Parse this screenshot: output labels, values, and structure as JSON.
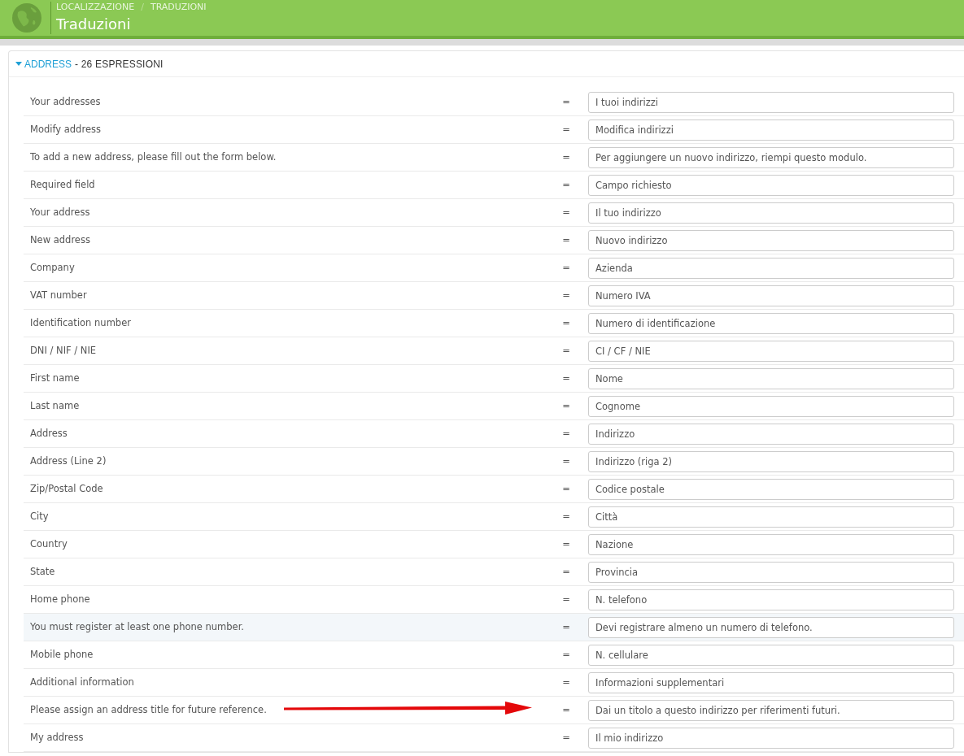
{
  "header": {
    "breadcrumb": [
      "LOCALIZZAZIONE",
      "TRADUZIONI"
    ],
    "separator": "/",
    "title": "Traduzioni"
  },
  "section": {
    "name": "ADDRESS",
    "count": "- 26 ESPRESSIONI",
    "expanded": true
  },
  "rows": [
    {
      "source": "Your addresses",
      "equals": "=",
      "value": "I tuoi indirizzi",
      "highlighted": false,
      "arrow": false
    },
    {
      "source": "Modify address",
      "equals": "=",
      "value": "Modifica indirizzi",
      "highlighted": false,
      "arrow": false
    },
    {
      "source": "To add a new address, please fill out the form below.",
      "equals": "=",
      "value": "Per aggiungere un nuovo indirizzo, riempi questo modulo.",
      "highlighted": false,
      "arrow": false
    },
    {
      "source": "Required field",
      "equals": "=",
      "value": "Campo richiesto",
      "highlighted": false,
      "arrow": false
    },
    {
      "source": "Your address",
      "equals": "=",
      "value": "Il tuo indirizzo",
      "highlighted": false,
      "arrow": false
    },
    {
      "source": "New address",
      "equals": "=",
      "value": "Nuovo indirizzo",
      "highlighted": false,
      "arrow": false
    },
    {
      "source": "Company",
      "equals": "=",
      "value": "Azienda",
      "highlighted": false,
      "arrow": false
    },
    {
      "source": "VAT number",
      "equals": "=",
      "value": "Numero IVA",
      "highlighted": false,
      "arrow": false
    },
    {
      "source": "Identification number",
      "equals": "=",
      "value": "Numero di identificazione",
      "highlighted": false,
      "arrow": false
    },
    {
      "source": "DNI / NIF / NIE",
      "equals": "=",
      "value": "CI / CF / NIE",
      "highlighted": false,
      "arrow": false
    },
    {
      "source": "First name",
      "equals": "=",
      "value": "Nome",
      "highlighted": false,
      "arrow": false
    },
    {
      "source": "Last name",
      "equals": "=",
      "value": "Cognome",
      "highlighted": false,
      "arrow": false
    },
    {
      "source": "Address",
      "equals": "=",
      "value": "Indirizzo",
      "highlighted": false,
      "arrow": false
    },
    {
      "source": "Address (Line 2)",
      "equals": "=",
      "value": "Indirizzo (riga 2)",
      "highlighted": false,
      "arrow": false
    },
    {
      "source": "Zip/Postal Code",
      "equals": "=",
      "value": "Codice postale",
      "highlighted": false,
      "arrow": false
    },
    {
      "source": "City",
      "equals": "=",
      "value": "Città",
      "highlighted": false,
      "arrow": false
    },
    {
      "source": "Country",
      "equals": "=",
      "value": "Nazione",
      "highlighted": false,
      "arrow": false
    },
    {
      "source": "State",
      "equals": "=",
      "value": "Provincia",
      "highlighted": false,
      "arrow": false
    },
    {
      "source": "Home phone",
      "equals": "=",
      "value": "N. telefono",
      "highlighted": false,
      "arrow": false
    },
    {
      "source": "You must register at least one phone number.",
      "equals": "=",
      "value": "Devi registrare almeno un numero di telefono.",
      "highlighted": true,
      "arrow": false
    },
    {
      "source": "Mobile phone",
      "equals": "=",
      "value": "N. cellulare",
      "highlighted": false,
      "arrow": false
    },
    {
      "source": "Additional information",
      "equals": "=",
      "value": "Informazioni supplementari",
      "highlighted": false,
      "arrow": false
    },
    {
      "source": "Please assign an address title for future reference.",
      "equals": "=",
      "value": "Dai un titolo a questo indirizzo per riferimenti futuri.",
      "highlighted": false,
      "arrow": true
    },
    {
      "source": "My address",
      "equals": "=",
      "value": "Il mio indirizzo",
      "highlighted": false,
      "arrow": false
    }
  ]
}
